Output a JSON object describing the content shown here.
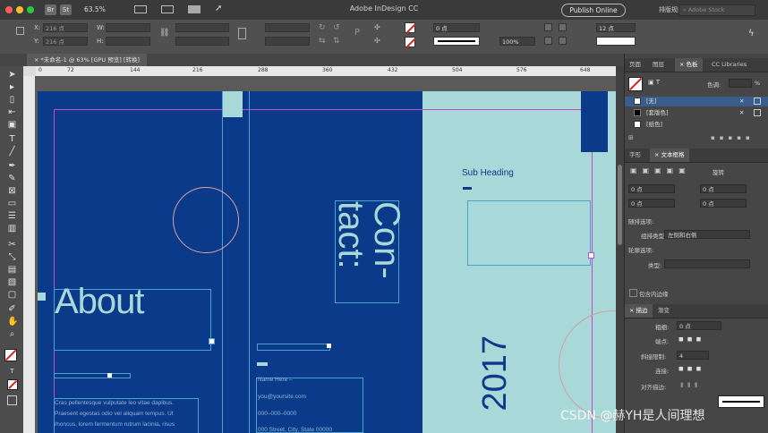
{
  "window": {
    "title": "Adobe InDesign CC",
    "zoom": "63.5%",
    "publish_label": "Publish Online",
    "workspace_label": "排版规则",
    "stock_placeholder": "Adobe Stock",
    "mode_icons": [
      "Br",
      "St"
    ]
  },
  "control_bar": {
    "x_label": "X:",
    "x_value": "216 点",
    "y_label": "Y:",
    "y_value": "216 点",
    "w_label": "W:",
    "h_label": "H:",
    "stroke_weight": "0 点",
    "opacity": "100%",
    "corner_size": "12 点"
  },
  "document_tab": {
    "label": "*未命名-1 @ 63% [GPU 预览] [转换]",
    "close": "×"
  },
  "ruler": {
    "ticks": [
      "0",
      "72",
      "144",
      "216",
      "288",
      "360",
      "432",
      "504",
      "576",
      "648"
    ]
  },
  "page": {
    "about": "About",
    "contact": "Con-\ntact:",
    "year": "2017",
    "sub_heading": "Sub Heading",
    "body_lines": [
      "Cras pellentesque vulputate leo vitae dapibus.",
      "Praesent egestas odio vel aliquam tempus. Ut",
      "rhoncus, lorem fermentum rutrum lacinia, risus"
    ],
    "contact_lines": [
      "Name Here –",
      "you@yoursite.com",
      "000–000–0000",
      "000 Street, City, State 00000"
    ]
  },
  "panels": {
    "top_tabs": [
      "页面",
      "图层",
      "色板",
      "CC Libraries"
    ],
    "active_top_tab": "色板",
    "tint_label": "色调:",
    "tint_unit": "%",
    "swatches": [
      {
        "name": "[无]",
        "color": "#ffffff"
      },
      {
        "name": "[套版色]",
        "color": "#000000"
      },
      {
        "name": "[纸色]",
        "color": "#ffffff"
      }
    ],
    "text_tabs": [
      "字形",
      "文本框格"
    ],
    "rotate_label": "旋转",
    "zero_value": "0 点",
    "align_label": "随排选项:",
    "align_dropdown_label": "组排类型:",
    "align_value": "左侧和右侧",
    "wrap_label": "轮廓选项:",
    "type_label": "类型:",
    "include_inside": "包含内边缘",
    "stroke_tabs": [
      "描边",
      "渐变"
    ],
    "weight_label": "粗细:",
    "weight_value": "0 点",
    "cap_label": "端点:",
    "miter_label": "斜接限制:",
    "miter_value": "4",
    "join_label": "连接:",
    "align_stroke_label": "对齐描边:"
  },
  "watermark": "CSDN @赫YH是人间理想",
  "colors": {
    "page_blue": "#0c3a8a",
    "page_teal": "#a9d8d8",
    "guide": "#c34bc8"
  }
}
